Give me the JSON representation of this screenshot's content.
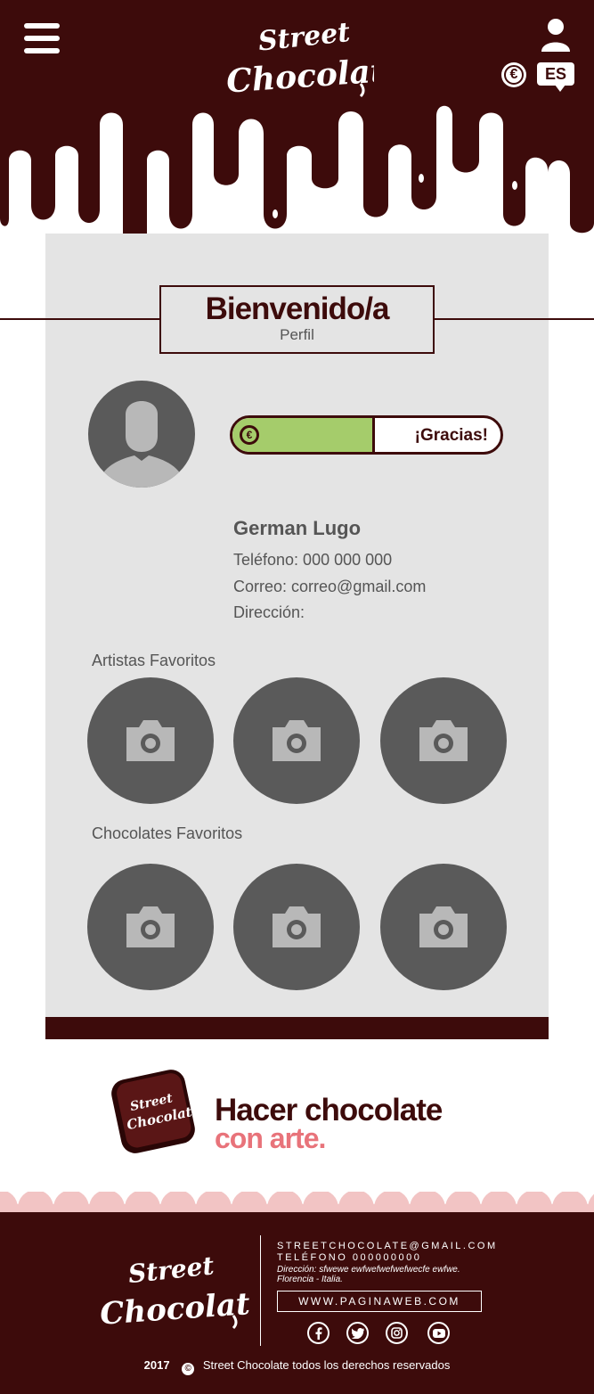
{
  "colors": {
    "brand": "#3d0b0b",
    "panel": "#e4e4e4",
    "accent_green": "#a5cc6b",
    "accent_pink": "#e8737a",
    "scallop": "#f2c4c4",
    "placeholder": "#5a5a5a"
  },
  "header": {
    "menu_icon": "hamburger-icon",
    "logo_text_1": "Street",
    "logo_text_2": "Chocolate",
    "user_icon": "user-icon",
    "currency_symbol": "€",
    "language": "ES"
  },
  "profile": {
    "title": "Bienvenido/a",
    "subtitle": "Perfil",
    "progress": {
      "coin": "€",
      "label": "¡Gracias!",
      "fill_fraction": 0.52
    },
    "name": "German Lugo",
    "phone": "Teléfono: 000 000 000",
    "email": "Correo: correo@gmail.com",
    "address": "Dirección:"
  },
  "favorites": {
    "artists_title": "Artistas Favoritos",
    "chocolates_title": "Chocolates Favoritos",
    "photo_icon": "camera-icon"
  },
  "slogan": {
    "line1": "Hacer chocolate",
    "line2": "con arte."
  },
  "footer": {
    "email": "STREETCHOCOLATE@GMAIL.COM",
    "phone": "TELÉFONO 000000000",
    "address_1": "Dirección: sfwewe ewfwefwefwefwecfe ewfwe.",
    "address_2": "Florencia - Italia.",
    "website": "WWW.PAGINAWEB.COM",
    "social": [
      "facebook-icon",
      "twitter-icon",
      "instagram-icon",
      "youtube-icon"
    ],
    "copyright_year": "2017",
    "copyright_symbol": "©",
    "copyright_text": "Street Chocolate todos los derechos reservados"
  }
}
